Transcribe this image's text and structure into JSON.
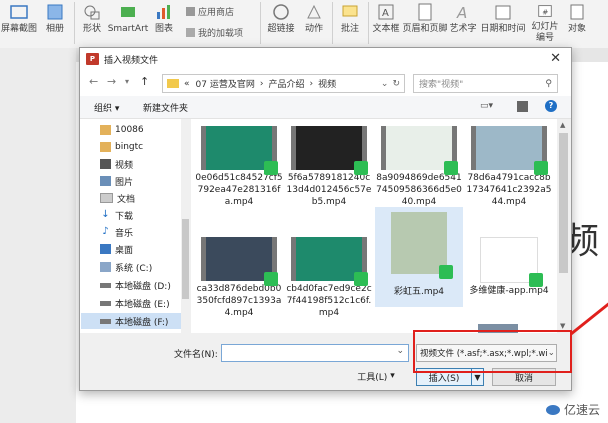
{
  "ribbon": {
    "screenshot": "屏幕截图",
    "album": "相册",
    "shapes": "形状",
    "smartart": "SmartArt",
    "chart": "图表",
    "store": "应用商店",
    "my_addins": "我的加载项",
    "hyperlink": "超链接",
    "action": "动作",
    "comment": "批注",
    "textbox": "文本框",
    "header_footer": "页眉和页脚",
    "wordart": "艺术字",
    "datetime": "日期和时间",
    "slide_number": "幻灯片\n编号",
    "object": "对象"
  },
  "dialog": {
    "title": "插入视频文件",
    "close": "✕",
    "path": [
      "07 运营及官网",
      "产品介绍",
      "视频"
    ],
    "path_prefix": "«",
    "search_placeholder": "搜索\"视频\"",
    "organize": "组织 ▾",
    "new_folder": "新建文件夹"
  },
  "tree": [
    {
      "label": "10086",
      "icon": "user-folder-icon"
    },
    {
      "label": "bingtc",
      "icon": "user-folder-icon"
    },
    {
      "label": "视频",
      "icon": "video-folder-icon"
    },
    {
      "label": "图片",
      "icon": "picture-folder-icon"
    },
    {
      "label": "文档",
      "icon": "document-folder-icon"
    },
    {
      "label": "下载",
      "icon": "download-icon"
    },
    {
      "label": "音乐",
      "icon": "music-icon"
    },
    {
      "label": "桌面",
      "icon": "desktop-icon"
    },
    {
      "label": "系统 (C:)",
      "icon": "system-drive-icon"
    },
    {
      "label": "本地磁盘 (D:)",
      "icon": "drive-icon"
    },
    {
      "label": "本地磁盘 (E:)",
      "icon": "drive-icon"
    },
    {
      "label": "本地磁盘 (F:)",
      "icon": "drive-icon"
    }
  ],
  "files": [
    {
      "name": "0e06d51c84527cf5792ea47e281316fa.mp4"
    },
    {
      "name": "5f6a5789181240c13d4d012456c57eb5.mp4"
    },
    {
      "name": "8a9094869de654174509586366d5e040.mp4"
    },
    {
      "name": "78d6a4791cacc8b17347641c2392a544.mp4"
    },
    {
      "name": "ca33d876debd0b0350fcfd897c1393a4.mp4"
    },
    {
      "name": "cb4d0fac7ed9ce2c7f44198f512c1c6f.mp4"
    },
    {
      "name": "彩虹五.mp4"
    },
    {
      "name": "多维健康-app.mp4"
    }
  ],
  "bottom": {
    "filename_label": "文件名(N):",
    "filename_value": "",
    "filter": "视频文件 (*.asf;*.asx;*.wpl;*.wi",
    "tools": "工具(L)",
    "insert": "插入(S)",
    "cancel": "取消"
  },
  "watermark": "亿速云",
  "colors": {
    "highlight": "#e0201c",
    "badge": "#2dbd54",
    "selected": "#cde0f5"
  }
}
